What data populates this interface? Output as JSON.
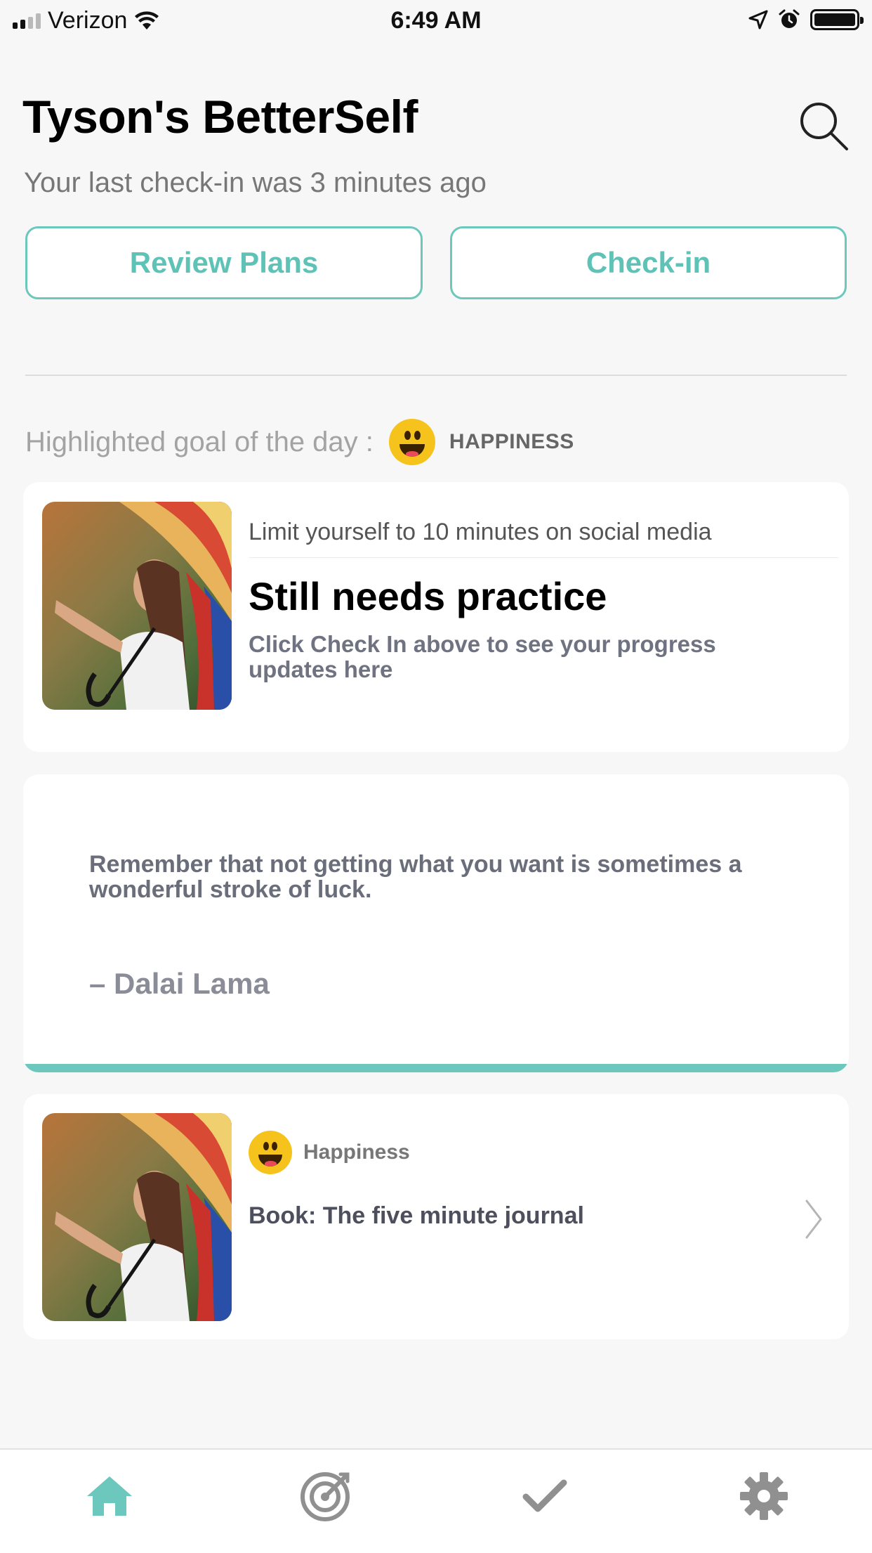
{
  "status_bar": {
    "carrier": "Verizon",
    "time": "6:49 AM",
    "icons": [
      "signal-icon",
      "wifi-icon",
      "location-arrow-icon",
      "alarm-icon",
      "battery-icon"
    ]
  },
  "header": {
    "title": "Tyson's BetterSelf",
    "subtitle": "Your last check-in was 3 minutes ago",
    "search_icon": "search-icon"
  },
  "actions": {
    "review_label": "Review Plans",
    "checkin_label": "Check-in"
  },
  "highlight": {
    "label": "Highlighted goal of the day :",
    "category": "HAPPINESS",
    "emoji": "happy-face-icon"
  },
  "goal_card": {
    "title": "Limit yourself to 10 minutes on social media",
    "status": "Still needs practice",
    "hint": "Click Check In above to see your progress updates here"
  },
  "quote_card": {
    "text": "Remember that not getting what you want is sometimes a wonderful stroke of luck.",
    "author": "– Dalai Lama"
  },
  "plan_card": {
    "category": "Happiness",
    "title": "Book: The five minute journal"
  },
  "tabs": [
    {
      "name": "home",
      "icon": "home-icon",
      "active": true
    },
    {
      "name": "goals",
      "icon": "target-icon",
      "active": false
    },
    {
      "name": "check-in",
      "icon": "checkmark-icon",
      "active": false
    },
    {
      "name": "settings",
      "icon": "gear-icon",
      "active": false
    }
  ],
  "colors": {
    "accent": "#6cc7bc",
    "accent_text": "#5ec3b6",
    "inactive_icon": "#909090",
    "emoji": "#f6c21c"
  }
}
